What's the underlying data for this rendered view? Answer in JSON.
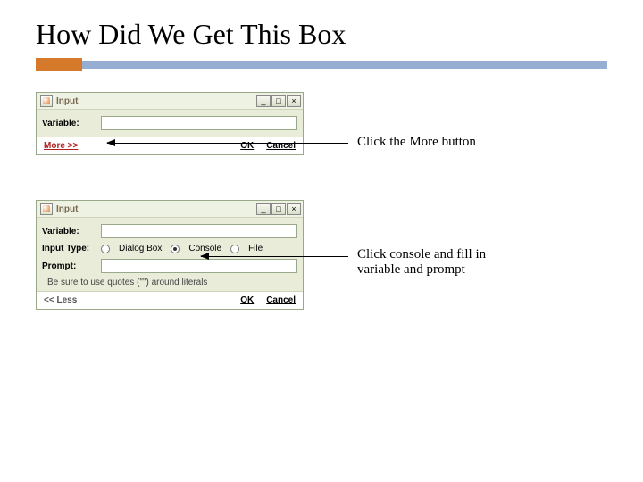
{
  "title": "How Did We Get This Box",
  "dialog1": {
    "windowTitle": "Input",
    "variableLabel": "Variable:",
    "variableValue": "",
    "moreLabel": "More >>",
    "okLabel": "OK",
    "cancelLabel": "Cancel"
  },
  "dialog2": {
    "windowTitle": "Input",
    "variableLabel": "Variable:",
    "variableValue": "",
    "inputTypeLabel": "Input Type:",
    "optionDialog": "Dialog Box",
    "optionConsole": "Console",
    "optionFile": "File",
    "promptLabel": "Prompt:",
    "promptValue": "",
    "hint": "Be sure to use quotes (\"\") around literals",
    "lessLabel": "<< Less",
    "okLabel": "OK",
    "cancelLabel": "Cancel"
  },
  "annotations": {
    "step1": "Click the More button",
    "step2a": "Click console and fill in",
    "step2b": "variable and prompt"
  }
}
